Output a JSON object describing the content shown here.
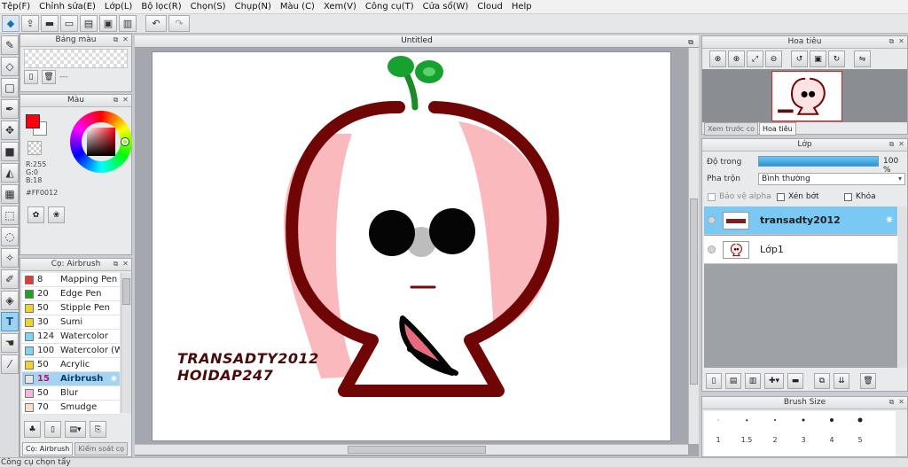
{
  "menu": [
    "Tệp(F)",
    "Chỉnh sửa(E)",
    "Lớp(L)",
    "Bộ lọc(R)",
    "Chọn(S)",
    "Chụp(N)",
    "Màu (C)",
    "Xem(V)",
    "Công cụ(T)",
    "Cửa sổ(W)",
    "Cloud",
    "Help"
  ],
  "panels": {
    "swatch_title": "Bảng màu",
    "swatch_hint": "---",
    "color_title": "Màu",
    "brush_title": "Cọ: Airbrush",
    "navigator_title": "Hoa tiêu",
    "layer_title": "Lớp",
    "brushsize_title": "Brush Size"
  },
  "color": {
    "foreground": "#FF0012",
    "background": "#FFFFFF",
    "r_text": "R:255",
    "g_text": "G:0",
    "b_text": "B:18",
    "hex_text": "#FF0012"
  },
  "brushes": [
    {
      "size": "8",
      "name": "Mapping Pen",
      "swatch": "#e53935"
    },
    {
      "size": "20",
      "name": "Edge Pen",
      "swatch": "#1ea31e"
    },
    {
      "size": "50",
      "name": "Stipple Pen",
      "swatch": "#f2d32b"
    },
    {
      "size": "30",
      "name": "Sumi",
      "swatch": "#f2d32b"
    },
    {
      "size": "124",
      "name": "Watercolor",
      "swatch": "#7fd3f2"
    },
    {
      "size": "100",
      "name": "Watercolor (Wet)",
      "swatch": "#7fd3f2"
    },
    {
      "size": "50",
      "name": "Acrylic",
      "swatch": "#f2d32b"
    },
    {
      "size": "15",
      "name": "Airbrush",
      "swatch": "#e6e6e6",
      "active": true
    },
    {
      "size": "50",
      "name": "Blur",
      "swatch": "#f4b8dc"
    },
    {
      "size": "70",
      "name": "Smudge",
      "swatch": "#f7dfc6"
    }
  ],
  "brush_tabs": [
    "Cọ: Airbrush",
    "Kiểm soát cọ"
  ],
  "canvas": {
    "tab_title": "Untitled",
    "watermark_line1": "TRANSADTY2012",
    "watermark_line2": "HOIDAP247"
  },
  "navigator_tabs": [
    "Xem trước co",
    "Hoa tiêu"
  ],
  "layer": {
    "opacity_label": "Độ trong",
    "opacity_value": "100 %",
    "opacity_fraction": 1.0,
    "blend_label": "Pha trộn",
    "blend_value": "Bình thường",
    "protect_alpha": "Bảo vệ alpha",
    "clipping": "Xén bớt",
    "lock": "Khóa",
    "layers": [
      {
        "name": "transadty2012",
        "active": true
      },
      {
        "name": "Lớp1",
        "active": false
      }
    ]
  },
  "brush_sizes": [
    "1",
    "1.5",
    "2",
    "3",
    "4",
    "5"
  ],
  "status": "Công cụ chọn tẩy"
}
